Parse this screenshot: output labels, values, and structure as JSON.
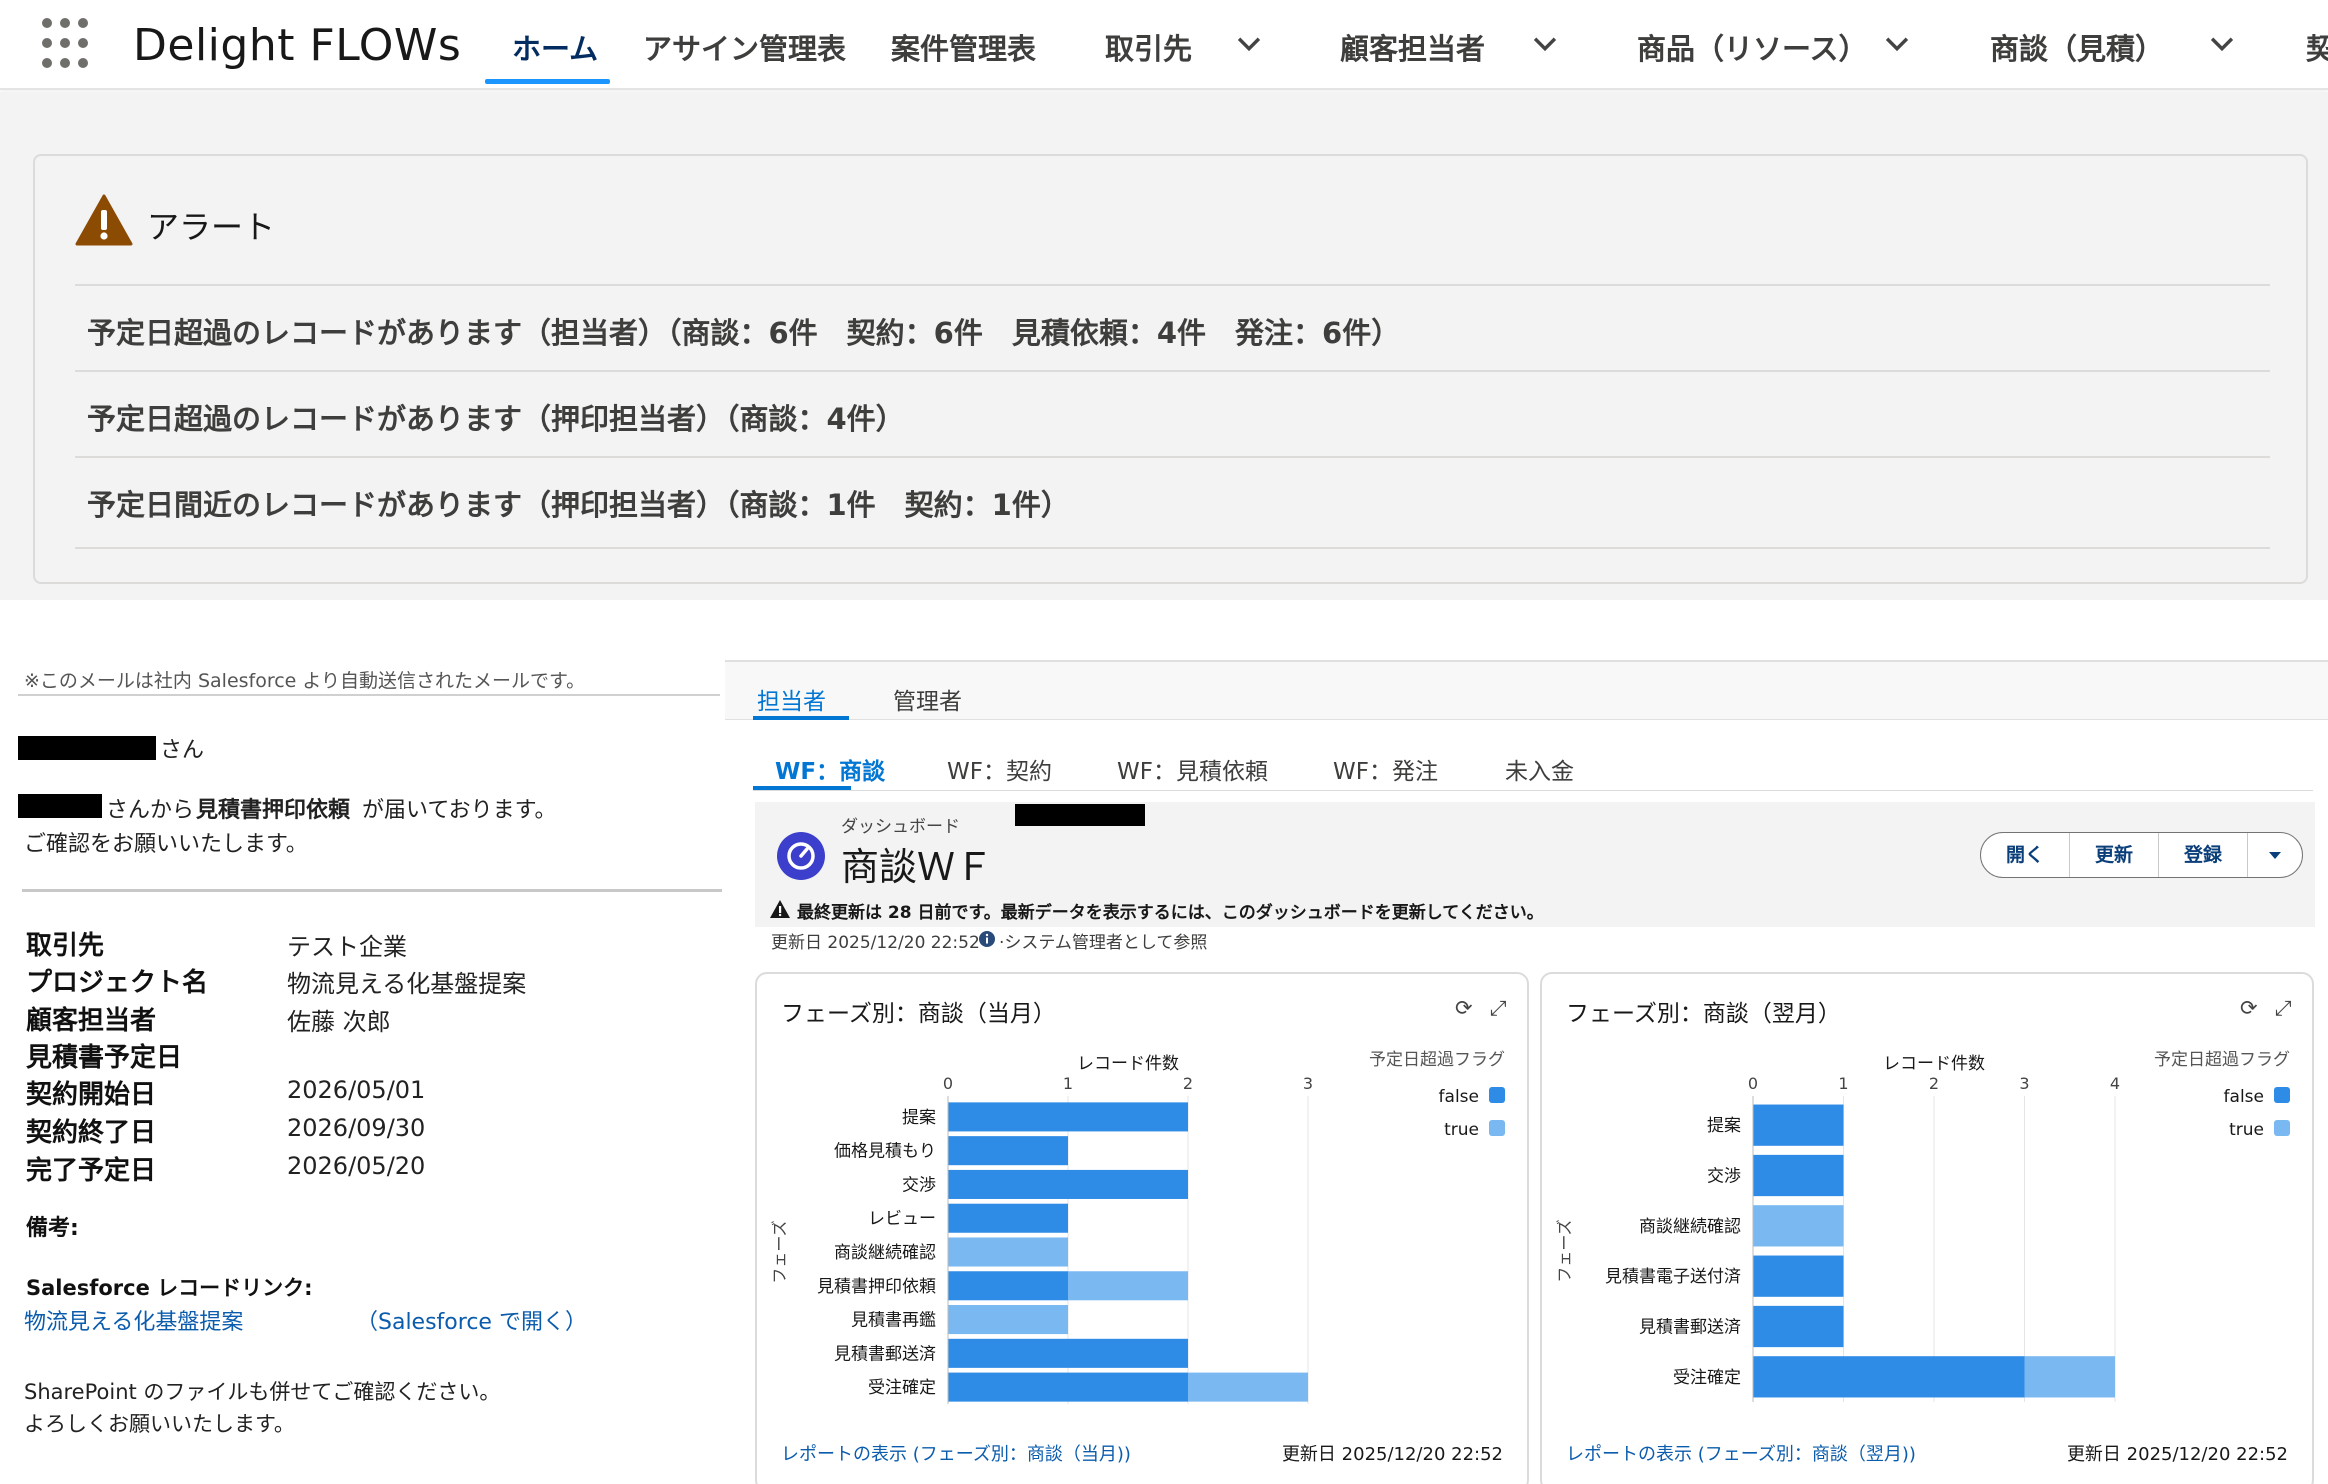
{
  "nav": {
    "app_name": "Delight FLOWs",
    "items": [
      "ホーム",
      "アサイン管理表",
      "案件管理表",
      "取引先",
      "顧客担当者",
      "商品（リソース）",
      "商談（見積）",
      "契"
    ]
  },
  "alerts": {
    "title": "アラート",
    "rows": [
      "予定日超過のレコードがあります（担当者）（商談：6件　契約：6件　見積依頼：4件　発注：6件）",
      "予定日超過のレコードがあります（押印担当者）（商談：4件）",
      "予定日間近のレコードがあります（押印担当者）（商談：1件　契約：1件）"
    ]
  },
  "email": {
    "note": "※このメールは社内 Salesforce より自動送信されたメールです。",
    "greeting_suffix": "さん",
    "line1_mid": "さんから",
    "line1_bold": "見積書押印依頼",
    "line1_end": "が届いております。",
    "line2": "ご確認をお願いいたします。",
    "fields": [
      {
        "label": "取引先",
        "value": "テスト企業"
      },
      {
        "label": "プロジェクト名",
        "value": "物流見える化基盤提案"
      },
      {
        "label": "顧客担当者",
        "value": "佐藤 次郎"
      },
      {
        "label": "見積書予定日",
        "value": ""
      },
      {
        "label": "契約開始日",
        "value": "2026/05/01"
      },
      {
        "label": "契約終了日",
        "value": "2026/09/30"
      },
      {
        "label": "完了予定日",
        "value": "2026/05/20"
      }
    ],
    "remarks_label": "備考:",
    "record_link_label": "Salesforce レコードリンク:",
    "record_link_text": "物流見える化基盤提案",
    "open_link_text": "（Salesforce で開く）",
    "footer1": "SharePoint のファイルも併せてご確認ください。",
    "footer2": "よろしくお願いいたします。"
  },
  "dashboard": {
    "tabs": [
      "担当者",
      "管理者"
    ],
    "subtabs": [
      "WF：商談",
      "WF：契約",
      "WF：見積依頼",
      "WF：発注",
      "未入金"
    ],
    "subtitle": "ダッシュボード",
    "title": "商談ＷＦ",
    "warning": "最終更新は 28 日前です。最新データを表示するには、このダッシュボードを更新してください。",
    "updated_prefix": "更新日 2025/12/20 22:52·",
    "viewing_as": "·システム管理者として参照",
    "buttons": [
      "開く",
      "更新",
      "登録"
    ],
    "icons": {
      "refresh": "refresh-icon",
      "expand": "expand-icon",
      "dropdown": "chevron-down-icon"
    },
    "colors": {
      "false": "#2e8be6",
      "true": "#7ab8f2",
      "accent": "#0176d3"
    }
  },
  "chart_data": [
    {
      "type": "bar",
      "orientation": "horizontal",
      "stacked": true,
      "title": "フェーズ別：商談（当月）",
      "xlabel": "レコード件数",
      "ylabel": "フェーズ",
      "xlim": [
        0,
        3
      ],
      "xticks": [
        "0",
        "1",
        "2",
        "3"
      ],
      "legend_title": "予定日超過フラグ",
      "legend_position": "top-right",
      "categories": [
        "提案",
        "価格見積もり",
        "交渉",
        "レビュー",
        "商談継続確認",
        "見積書押印依頼",
        "見積書再鑑",
        "見積書郵送済",
        "受注確定"
      ],
      "series": [
        {
          "name": "false",
          "values": [
            2,
            1,
            2,
            1,
            0,
            1,
            0,
            2,
            2
          ]
        },
        {
          "name": "true",
          "values": [
            0,
            0,
            0,
            0,
            1,
            1,
            1,
            0,
            1
          ]
        }
      ],
      "footer_link": "レポートの表示 (フェーズ別：商談（当月))",
      "footer_updated": "更新日 2025/12/20 22:52"
    },
    {
      "type": "bar",
      "orientation": "horizontal",
      "stacked": true,
      "title": "フェーズ別：商談（翌月）",
      "xlabel": "レコード件数",
      "ylabel": "フェーズ",
      "xlim": [
        0,
        4
      ],
      "xticks": [
        "0",
        "1",
        "2",
        "3",
        "4"
      ],
      "legend_title": "予定日超過フラグ",
      "legend_position": "top-right",
      "categories": [
        "提案",
        "交渉",
        "商談継続確認",
        "見積書電子送付済",
        "見積書郵送済",
        "受注確定"
      ],
      "series": [
        {
          "name": "false",
          "values": [
            1,
            1,
            0,
            1,
            1,
            3
          ]
        },
        {
          "name": "true",
          "values": [
            0,
            0,
            1,
            0,
            0,
            1
          ]
        }
      ],
      "footer_link": "レポートの表示 (フェーズ別：商談（翌月))",
      "footer_updated": "更新日 2025/12/20 22:52"
    }
  ]
}
